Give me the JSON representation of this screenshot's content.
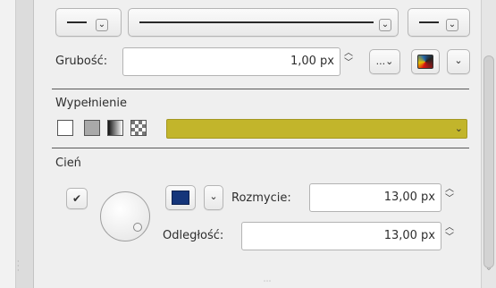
{
  "stroke": {
    "thickness_label": "Grubość:",
    "thickness_value": "1,00 px",
    "more_label": "...",
    "line_start_icon": "line-short",
    "line_style_icon": "line-long",
    "line_end_icon": "line-short"
  },
  "fill": {
    "section_title": "Wypełnienie",
    "color": "#c2b52b",
    "swatches": [
      "none",
      "solid",
      "gradient",
      "pattern"
    ]
  },
  "shadow": {
    "section_title": "Cień",
    "enabled": true,
    "color": "#15357a",
    "blur_label": "Rozmycie:",
    "blur_value": "13,00 px",
    "distance_label": "Odległość:",
    "distance_value": "13,00 px"
  }
}
